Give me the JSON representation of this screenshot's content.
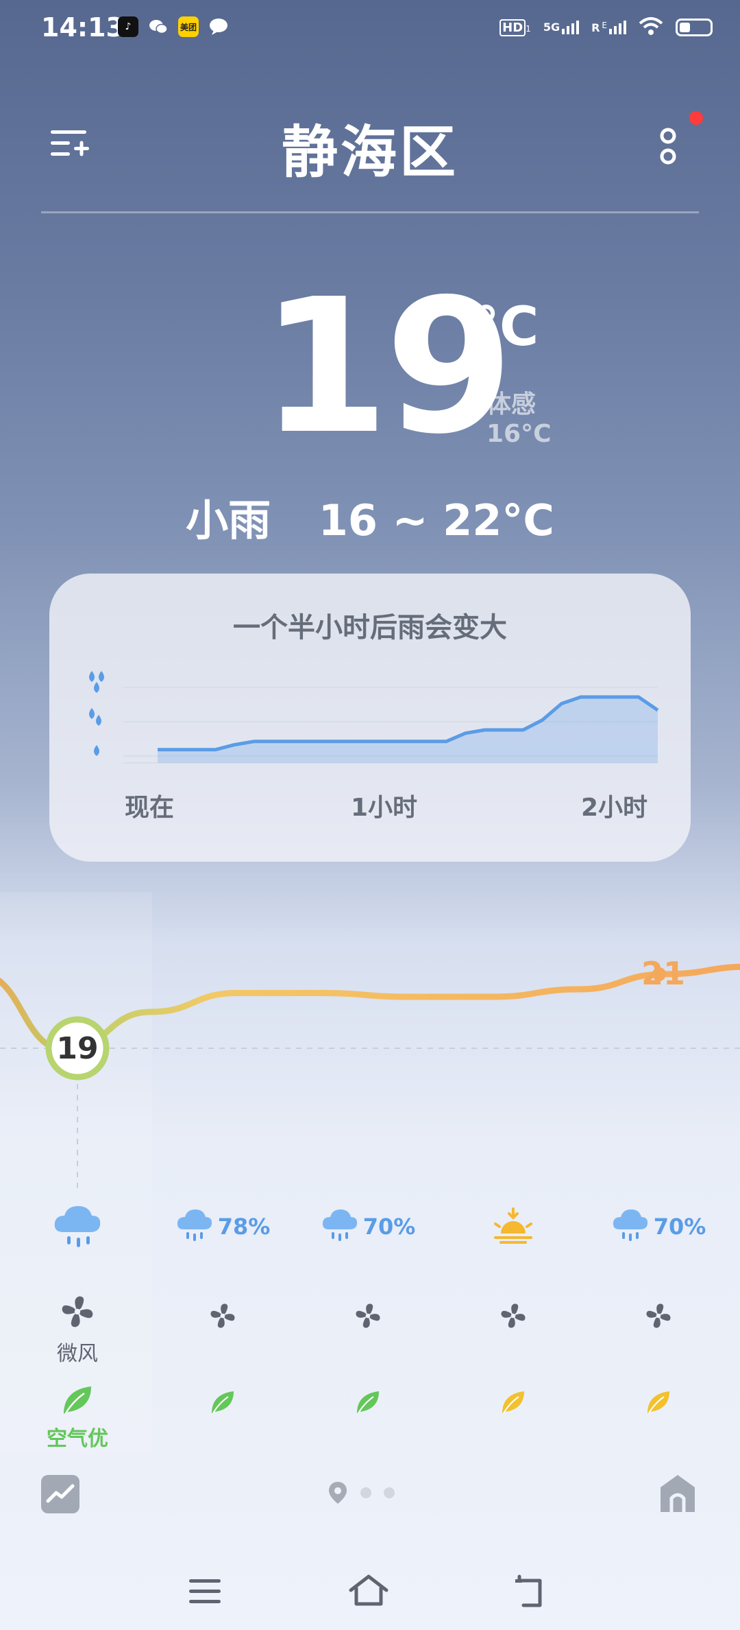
{
  "status_bar": {
    "time": "14:13",
    "meituan_label": "美团",
    "signal_1": "HD",
    "signal_1_sub": "1",
    "signal_2": "5G",
    "signal_3": "R",
    "signal_3_sup": "E",
    "battery_level": 0.35
  },
  "header": {
    "city": "静海区",
    "notification_dot": true
  },
  "current": {
    "temperature": "19",
    "unit": "°C",
    "feels_like_label": "体感",
    "feels_like_value": "16°C",
    "condition": "小雨",
    "range": "16 ~ 22°C"
  },
  "precipitation": {
    "title": "一个半小时后雨会变大",
    "labels": [
      "现在",
      "1小时",
      "2小时"
    ],
    "intensity_levels": [
      1,
      2,
      3
    ],
    "curve": [
      0.28,
      0.28,
      0.28,
      0.28,
      0.31,
      0.33,
      0.33,
      0.33,
      0.33,
      0.33,
      0.33,
      0.33,
      0.33,
      0.33,
      0.33,
      0.33,
      0.38,
      0.4,
      0.4,
      0.4,
      0.46,
      0.56,
      0.6,
      0.6,
      0.6,
      0.6,
      0.52
    ]
  },
  "hourly": {
    "current_temp": "19",
    "high_temp_label": "21",
    "temps": [
      21,
      19,
      20,
      20.5,
      20.5,
      20.4,
      20.4,
      20.6,
      21,
      21.2
    ],
    "columns": [
      {
        "weather_icon": "rain-cloud-icon",
        "pct": "",
        "wind_label": "微风",
        "aqi_label": "空气优",
        "aqi_color": "#63c75a"
      },
      {
        "weather_icon": "rain-cloud-icon",
        "pct": "78%",
        "wind_label": "",
        "aqi_label": "",
        "aqi_color": "#63c75a"
      },
      {
        "weather_icon": "rain-cloud-icon",
        "pct": "70%",
        "wind_label": "",
        "aqi_label": "",
        "aqi_color": "#63c75a"
      },
      {
        "weather_icon": "sunset-icon",
        "pct": "",
        "wind_label": "",
        "aqi_label": "",
        "aqi_color": "#f2c12e"
      },
      {
        "weather_icon": "rain-cloud-icon",
        "pct": "70%",
        "wind_label": "",
        "aqi_label": "",
        "aqi_color": "#f2c12e"
      }
    ]
  },
  "colors": {
    "rain_blue": "#5a9ce6",
    "temp_orange": "#f3a85c",
    "aqi_good": "#63c75a",
    "aqi_moderate": "#f2c12e"
  }
}
